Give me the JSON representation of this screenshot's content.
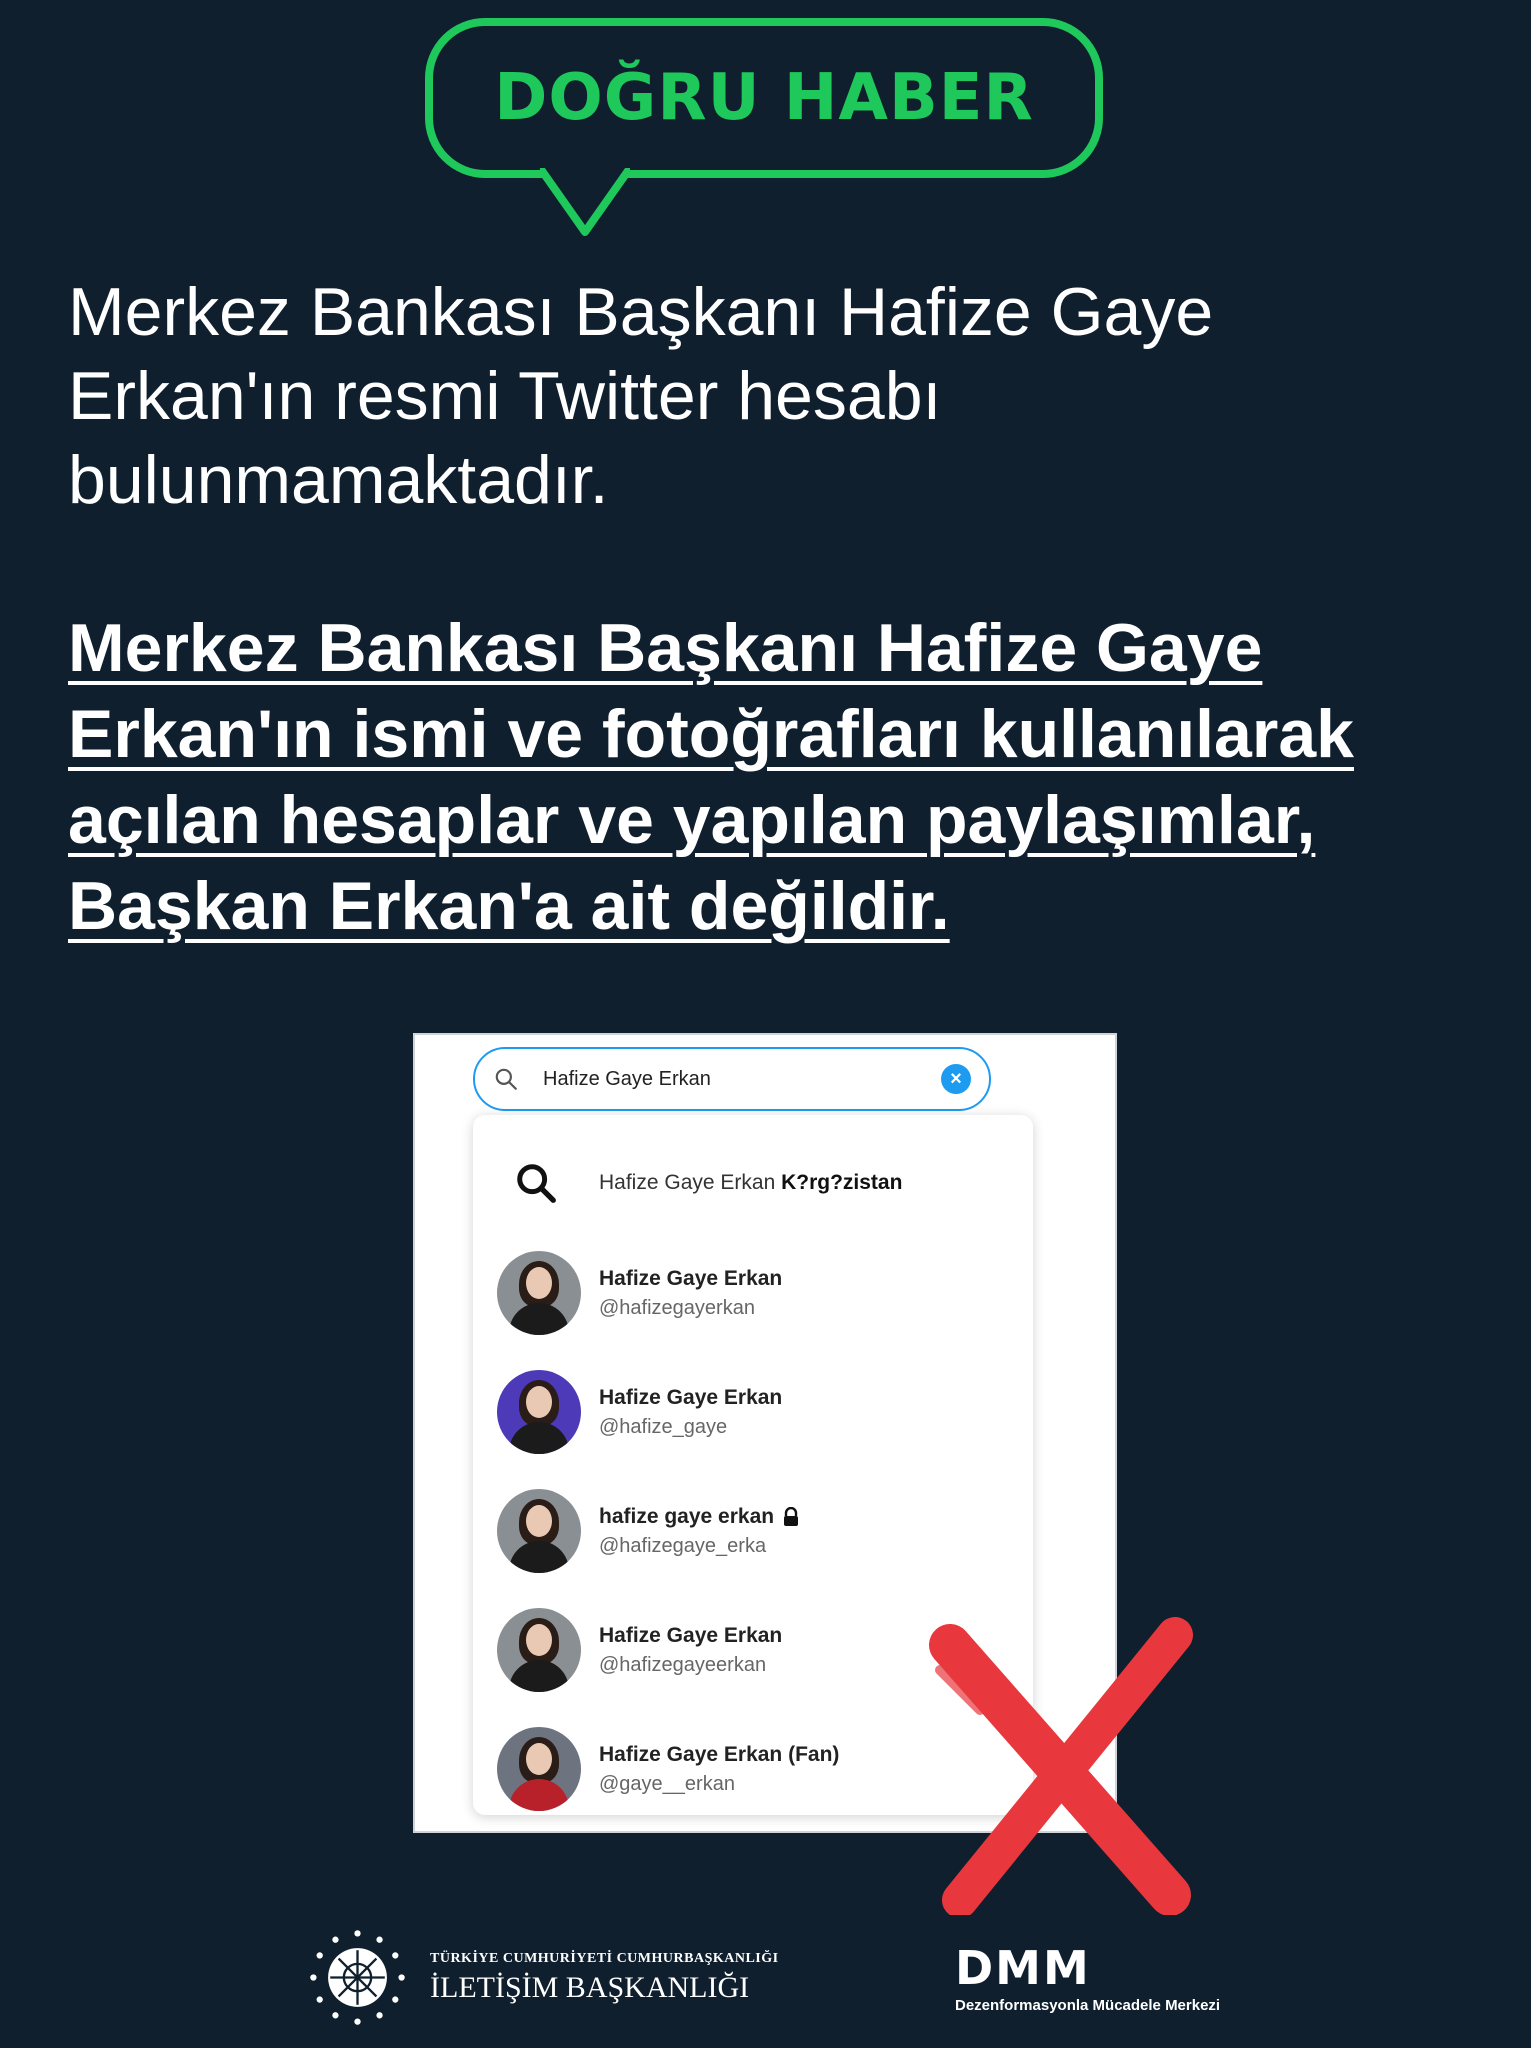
{
  "badge": {
    "label": "DOĞRU HABER"
  },
  "lead": {
    "text": "Merkez Bankası Başkanı Hafize Gaye Erkan'ın resmi Twitter hesabı bulunmamaktadır."
  },
  "headline": {
    "text": "Merkez Bankası Başkanı Hafize Gaye Erkan'ın ismi ve fotoğrafları kullanılarak açılan hesaplar ve yapılan paylaşımlar, Başkan Erkan'a ait değildir."
  },
  "screenshot": {
    "search_value": "Hafize Gaye Erkan",
    "query_suggestion": {
      "prefix": "Hafize Gaye Erkan ",
      "bold": "K?rg?zistan"
    },
    "accounts": [
      {
        "name": "Hafize Gaye Erkan",
        "handle": "@hafizegayerkan"
      },
      {
        "name": "Hafize Gaye Erkan",
        "handle": "@hafize_gaye"
      },
      {
        "name": "hafize gaye erkan",
        "handle": "@hafizegaye_erka"
      },
      {
        "name": "Hafize Gaye Erkan",
        "handle": "@hafizegayeerkan"
      },
      {
        "name": "Hafize Gaye Erkan (Fan)",
        "handle": "@gaye__erkan"
      }
    ]
  },
  "footer": {
    "left_small": "TÜRKİYE CUMHURİYETİ CUMHURBAŞKANLIĞI",
    "left_big": "İLETİŞİM BAŞKANLIĞI",
    "right_mark": "DMM",
    "right_sub": "Dezenformasyonla Mücadele Merkezi"
  },
  "colors": {
    "background": "#0f1f2e",
    "accent_green": "#1ec85a",
    "twitter_blue": "#1d9bf0",
    "cross_red": "#e8383d"
  },
  "icons": [
    "search-icon",
    "clear-icon",
    "lock-icon",
    "cross-icon",
    "emblem-icon"
  ]
}
